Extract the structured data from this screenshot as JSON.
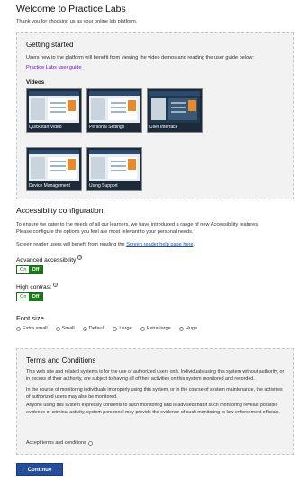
{
  "header": {
    "title": "Welcome to Practice Labs",
    "intro": "Thank you for choosing us as your online lab platform."
  },
  "getting_started": {
    "heading": "Getting started",
    "text": "Users new to the platform will benefit from viewing the video demos and reading the user guide below:",
    "guide_link": "Practice Labs user guide",
    "videos_heading": "Videos",
    "videos": [
      {
        "label": "Quickstart Video"
      },
      {
        "label": "Personal Settings"
      },
      {
        "label": "User Interface"
      },
      {
        "label": "Device Management"
      },
      {
        "label": "Using Support"
      }
    ]
  },
  "accessibility": {
    "heading": "Accessibilty configuration",
    "line1": "To ensure we cater to the needs of all our learners, we have introduced a range of new Accessibility features.",
    "line2": "Please configure the options you feel are most relevant to your personal needs.",
    "reader_prefix": "Screen reader users will benefit from reading the ",
    "reader_link": "Screen reader help page here",
    "reader_suffix": ".",
    "advanced_label": "Advanced accessibility",
    "contrast_label": "High contrast",
    "toggle_on": "On",
    "toggle_off": "Off",
    "help_icon": "?"
  },
  "font_size": {
    "label": "Font size",
    "options": [
      "Extra small",
      "Small",
      "Default",
      "Large",
      "Extra large",
      "Huge"
    ],
    "selected": "Default"
  },
  "terms": {
    "heading": "Terms and Conditions",
    "p1": "This web site and related systems is for the use of authorized users only. Individuals using this system without authority, or in excess of their authority, are subject to having all of their activities on this system monitored and recorded.",
    "p2": "In the course of monitoring individuals improperly using this system, or in the course of system maintenance, the activities of authorized users may also be monitored.",
    "p3": "Anyone using this system expressly consents to such monitoring and is advised that if such monitoring reveals possible evidence of criminal activity, system personnel may provide the evidence of such monitoring to law enforcement officials.",
    "accept": "Accept terms and conditions"
  },
  "actions": {
    "continue": "Continue"
  },
  "colors": {
    "toggle_green": "#1a7a1a",
    "button_blue": "#244e9c",
    "link_purple": "#5a1a9a",
    "link_blue": "#1a4fb0",
    "thumb_accent": "#e88a2c"
  }
}
